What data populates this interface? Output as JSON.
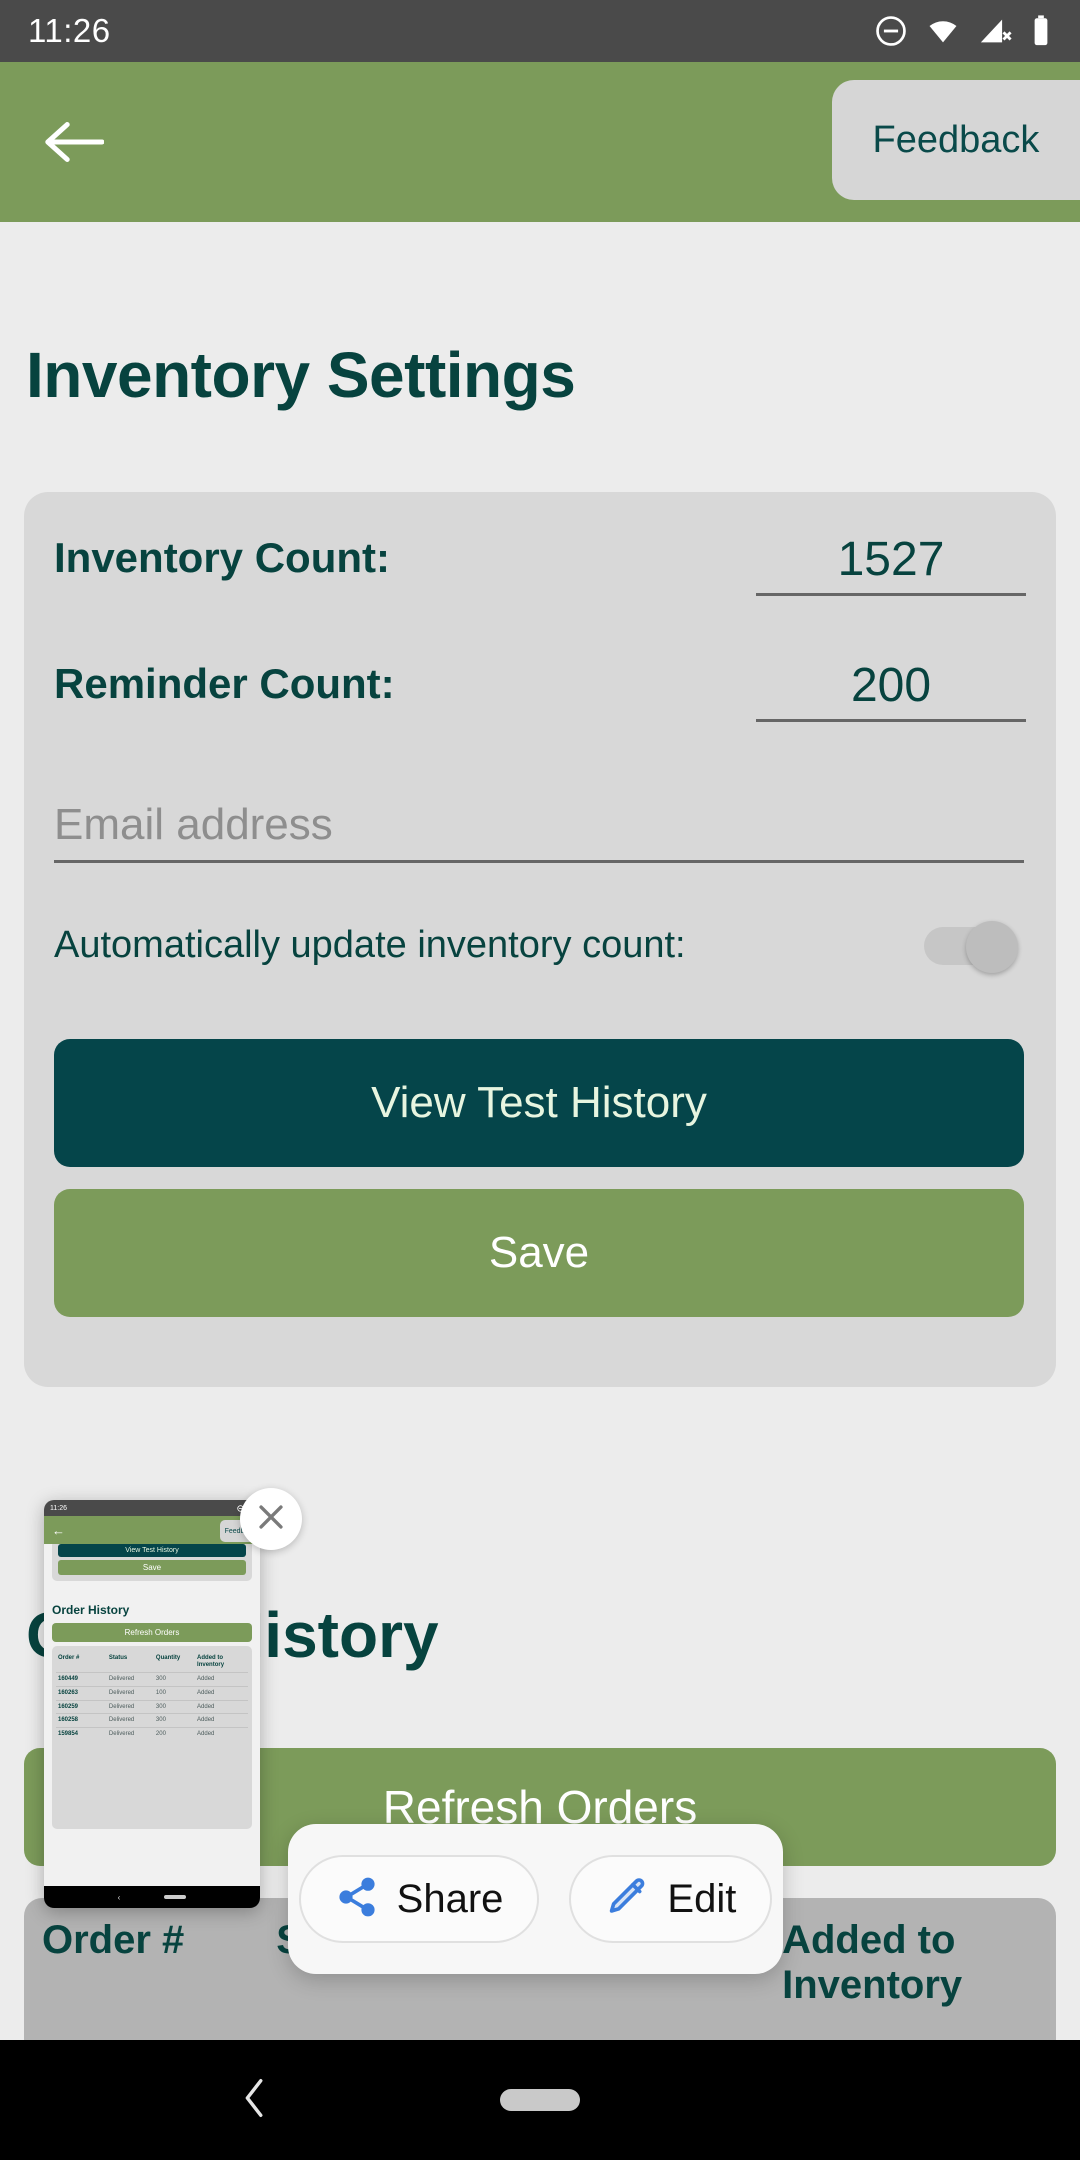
{
  "status_bar": {
    "time": "11:26",
    "icons": [
      "do-not-disturb-icon",
      "wifi-icon",
      "cellular-off-icon",
      "battery-icon"
    ]
  },
  "app_bar": {
    "back_icon": "back-arrow-icon",
    "feedback_label": "Feedback"
  },
  "page": {
    "title": "Inventory Settings"
  },
  "settings": {
    "inventory_count_label": "Inventory Count:",
    "inventory_count_value": "1527",
    "reminder_count_label": "Reminder Count:",
    "reminder_count_value": "200",
    "email_placeholder": "Email address",
    "email_value": "",
    "auto_update_label": "Automatically update inventory count:",
    "auto_update_state": "off",
    "view_history_label": "View Test History",
    "save_label": "Save"
  },
  "order_history": {
    "title": "Order History",
    "refresh_label": "Refresh Orders",
    "columns": [
      "Order #",
      "Status",
      "Quantity",
      "Added to Inventory"
    ],
    "rows": [
      {
        "order": "160449",
        "status": "Delivered",
        "quantity": "300",
        "added": "Added"
      },
      {
        "order": "160263",
        "status": "Delivered",
        "quantity": "100",
        "added": "Added"
      },
      {
        "order": "160259",
        "status": "Delivered",
        "quantity": "300",
        "added": "Added"
      },
      {
        "order": "160258",
        "status": "Delivered",
        "quantity": "300",
        "added": "Added"
      },
      {
        "order": "159854",
        "status": "Delivered",
        "quantity": "200",
        "added": "Added"
      }
    ]
  },
  "thumbnail": {
    "status_time": "11:26",
    "feedback_label": "Feedback",
    "view_history_label": "View Test History",
    "save_label": "Save",
    "order_title": "Order History",
    "refresh_label": "Refresh Orders",
    "close_icon": "close-icon"
  },
  "action_popup": {
    "share_label": "Share",
    "share_icon": "share-icon",
    "edit_label": "Edit",
    "edit_icon": "pencil-icon"
  },
  "nav_bar": {
    "back_icon": "nav-back-icon",
    "home_pill": "home-pill"
  },
  "colors": {
    "green": "#7c9b5a",
    "teal": "#07433f",
    "dark_teal_button": "#05454a",
    "card_gray": "#d8d8d8",
    "page_bg": "#ececec",
    "blue_accent": "#3b7ddd"
  }
}
